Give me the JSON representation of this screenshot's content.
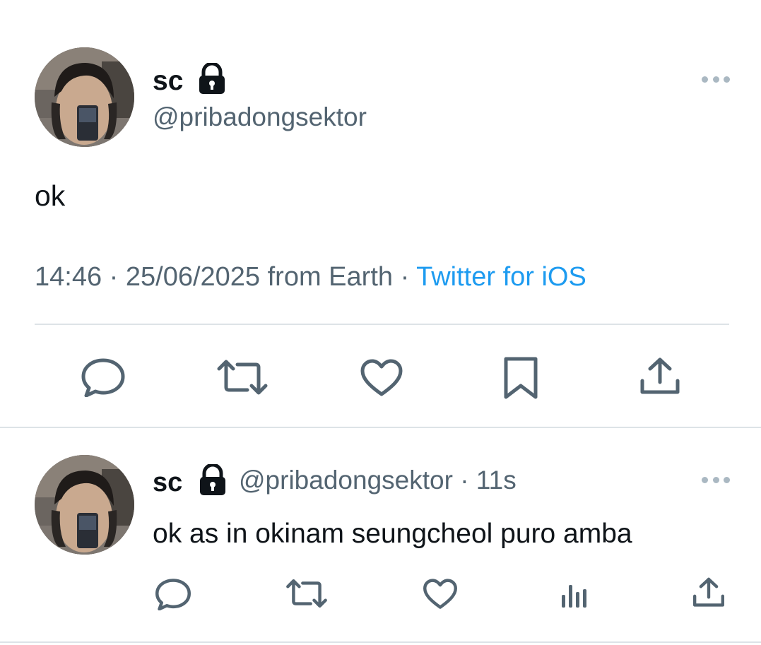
{
  "main_tweet": {
    "author": {
      "display_name": "sc",
      "handle": "@pribadongsektor",
      "protected_icon": "lock-icon",
      "avatar": "avatar-photo"
    },
    "more_icon": "more-horizontal-icon",
    "text": "ok",
    "time": "14:46",
    "date": "25/06/2025",
    "location": "from Earth",
    "client": "Twitter for iOS",
    "separator": "·",
    "actions": [
      {
        "name": "reply",
        "icon": "comment-icon"
      },
      {
        "name": "retweet",
        "icon": "retweet-icon"
      },
      {
        "name": "like",
        "icon": "heart-icon"
      },
      {
        "name": "bookmark",
        "icon": "bookmark-icon"
      },
      {
        "name": "share",
        "icon": "share-icon"
      }
    ]
  },
  "reply_tweet": {
    "author": {
      "display_name": "sc",
      "handle": "@pribadongsektor",
      "protected_icon": "lock-icon",
      "avatar": "avatar-photo"
    },
    "separator": "·",
    "time_ago": "11s",
    "more_icon": "more-horizontal-icon",
    "text": "ok as in okinam seungcheol puro amba",
    "actions": [
      {
        "name": "reply",
        "icon": "comment-icon"
      },
      {
        "name": "retweet",
        "icon": "retweet-icon"
      },
      {
        "name": "like",
        "icon": "heart-icon"
      },
      {
        "name": "views",
        "icon": "analytics-icon"
      },
      {
        "name": "share",
        "icon": "share-icon"
      }
    ]
  },
  "colors": {
    "text_primary": "#0f1419",
    "text_secondary": "#536471",
    "link": "#1d9bf0",
    "divider": "#dde3e7",
    "more_dots": "#aab8c2"
  }
}
